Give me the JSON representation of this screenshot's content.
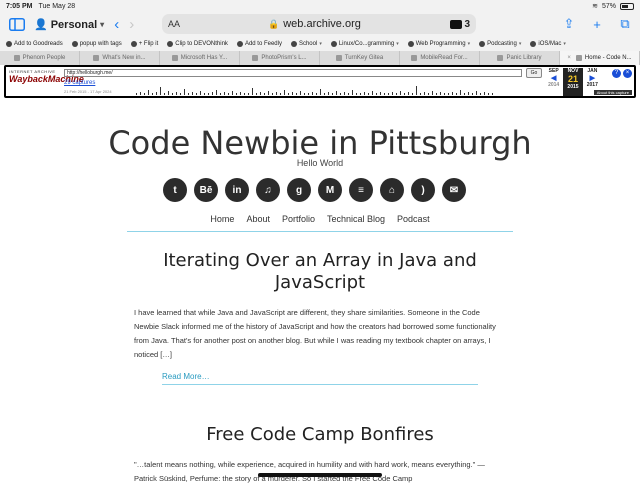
{
  "status": {
    "time": "7:05 PM",
    "date": "Tue May 28",
    "battery": "57%"
  },
  "toolbar": {
    "profile": "Personal",
    "aa": "AA",
    "url": "web.archive.org",
    "ext_count": "3"
  },
  "bookmarks": [
    {
      "label": "Add to Goodreads",
      "chev": false
    },
    {
      "label": "popup with tags",
      "chev": false
    },
    {
      "label": "+ Flip it",
      "chev": false
    },
    {
      "label": "Clip to DEVONthink",
      "chev": false
    },
    {
      "label": "Add to Feedly",
      "chev": false
    },
    {
      "label": "School",
      "chev": true
    },
    {
      "label": "Linux/Co...gramming",
      "chev": true
    },
    {
      "label": "Web Programming",
      "chev": true
    },
    {
      "label": "Podcasting",
      "chev": true
    },
    {
      "label": "iOS/Mac",
      "chev": true
    }
  ],
  "tabs": [
    {
      "label": "Phenom People",
      "active": false
    },
    {
      "label": "What's New in...",
      "active": false
    },
    {
      "label": "Microsoft Has Y...",
      "active": false
    },
    {
      "label": "PhotoPrism's L...",
      "active": false
    },
    {
      "label": "TurnKey Gitea",
      "active": false
    },
    {
      "label": "MobileRead For...",
      "active": false
    },
    {
      "label": "Panic Library",
      "active": false
    },
    {
      "label": "Home - Code N...",
      "active": true
    }
  ],
  "wayback": {
    "logo_small": "INTERNET ARCHIVE",
    "logo_big": "WaybackMachine",
    "url": "http://helloburgh.me/",
    "go": "Go",
    "captures": "29 captures",
    "range": "21 Feb 2015 - 17 Apr 2024",
    "cal": [
      {
        "month": "SEP",
        "day": "",
        "year": "2014"
      },
      {
        "month": "NOV",
        "day": "21",
        "year": "2015"
      },
      {
        "month": "JAN",
        "day": "",
        "year": "2017"
      }
    ],
    "about": "About this capture"
  },
  "site": {
    "title": "Code Newbie in Pittsburgh",
    "tagline": "Hello World",
    "socials": [
      {
        "icon": "twitter-icon",
        "glyph": "t"
      },
      {
        "icon": "behance-icon",
        "glyph": "Bē"
      },
      {
        "icon": "linkedin-icon",
        "glyph": "in"
      },
      {
        "icon": "itunes-icon",
        "glyph": "♫"
      },
      {
        "icon": "goodreads-icon",
        "glyph": "g"
      },
      {
        "icon": "medium-icon",
        "glyph": "M"
      },
      {
        "icon": "stackoverflow-icon",
        "glyph": "≡"
      },
      {
        "icon": "github-icon",
        "glyph": "⌂"
      },
      {
        "icon": "rss-icon",
        "glyph": ")"
      },
      {
        "icon": "email-icon",
        "glyph": "✉"
      }
    ],
    "nav": [
      "Home",
      "About",
      "Portfolio",
      "Technical Blog",
      "Podcast"
    ]
  },
  "posts": [
    {
      "title_line1": "Iterating Over an Array in Java and",
      "title_line2": "JavaScript",
      "excerpt": "I have learned that while Java and JavaScript are different, they share similarities. Someone in the Code Newbie Slack informed me of the history of JavaScript and how the creators had borrowed some functionality from Java. That's for another post on another blog. But while I was reading my textbook chapter on arrays, I noticed […]",
      "read_more": "Read More…"
    },
    {
      "title_line1": "Free Code Camp Bonfires",
      "excerpt": "\"…talent means nothing, while experience, acquired in humility and with hard work, means everything.\" — Patrick Süskind, Perfume: the story of a murderer. So I started the Free Code Camp"
    }
  ]
}
